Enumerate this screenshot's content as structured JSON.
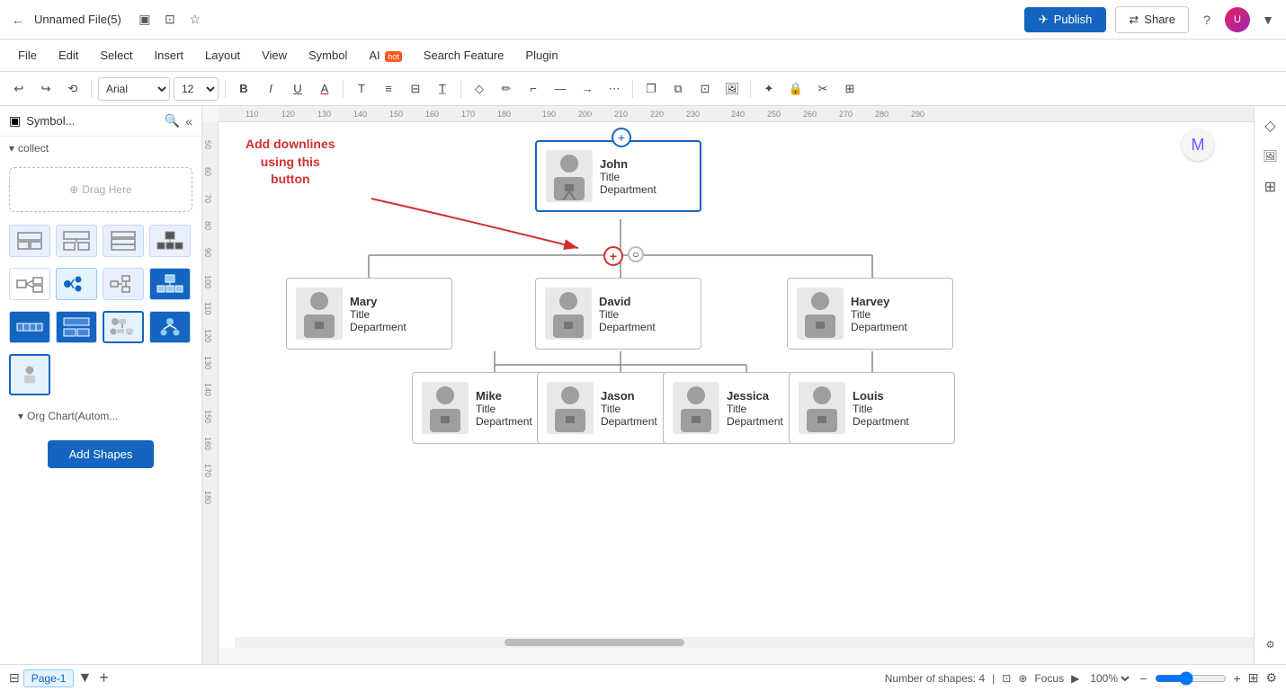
{
  "topbar": {
    "title": "Unnamed File(5)",
    "publish_label": "Publish",
    "share_label": "Share",
    "avatar_text": "U"
  },
  "menubar": {
    "items": [
      "File",
      "Edit",
      "Select",
      "Insert",
      "Layout",
      "View",
      "Symbol",
      "AI",
      "Search Feature",
      "Plugin"
    ],
    "ai_badge": "hot"
  },
  "toolbar": {
    "font": "Arial",
    "font_size": "12",
    "undo_label": "↩",
    "redo_label": "↪"
  },
  "sidebar": {
    "title": "Symbol...",
    "collect_label": "collect",
    "drag_label": "Drag Here",
    "org_section": "Org Chart(Autom...",
    "add_shapes": "Add Shapes"
  },
  "org_chart": {
    "nodes": [
      {
        "id": "john",
        "name": "John",
        "title": "Title",
        "department": "Department"
      },
      {
        "id": "mary",
        "name": "Mary",
        "title": "Title",
        "department": "Department"
      },
      {
        "id": "david",
        "name": "David",
        "title": "Title",
        "department": "Department"
      },
      {
        "id": "harvey",
        "name": "Harvey",
        "title": "Title",
        "department": "Department"
      },
      {
        "id": "mike",
        "name": "Mike",
        "title": "Title",
        "department": "Department"
      },
      {
        "id": "jason",
        "name": "Jason",
        "title": "Title",
        "department": "Department"
      },
      {
        "id": "jessica",
        "name": "Jessica",
        "title": "Title",
        "department": "Department"
      },
      {
        "id": "louis",
        "name": "Louis",
        "title": "Title",
        "department": "Department"
      }
    ]
  },
  "annotation": {
    "text": "Add downlines\nusing this\nbutton"
  },
  "statusbar": {
    "page_label": "Page-1",
    "shapes_label": "Number of shapes: 4",
    "focus_label": "Focus",
    "zoom_label": "100%",
    "page_tab": "Page-1",
    "add_page": "+"
  },
  "right_panel": {
    "format_icon": "◇",
    "image_icon": "🖼",
    "grid_icon": "⊞",
    "magic_icon": "M"
  },
  "ruler": {
    "h_marks": [
      "110",
      "120",
      "130",
      "140",
      "150",
      "160",
      "170",
      "180",
      "190",
      "200",
      "210",
      "220",
      "230",
      "240",
      "250",
      "260",
      "270",
      "280",
      "290"
    ],
    "v_marks": [
      "50",
      "60",
      "70",
      "80",
      "90",
      "100",
      "110",
      "120",
      "130",
      "140",
      "150",
      "160",
      "170",
      "180"
    ]
  }
}
